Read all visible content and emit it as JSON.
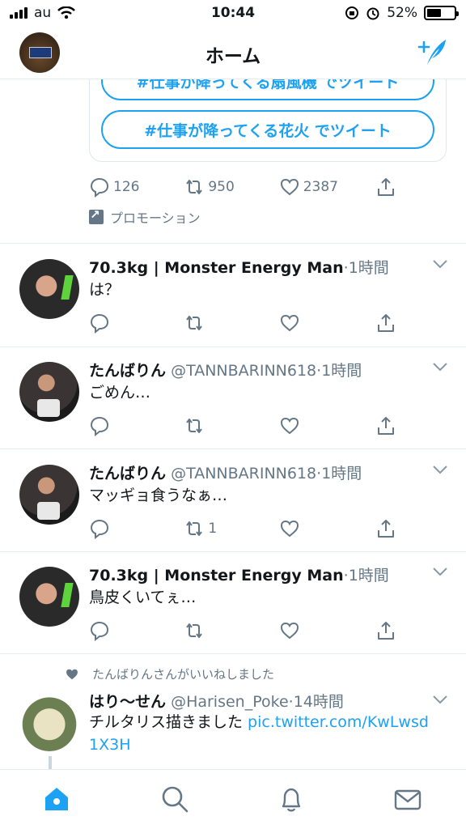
{
  "status_bar": {
    "carrier": "au",
    "time": "10:44",
    "battery_percent": "52%",
    "battery_level": 0.52
  },
  "header": {
    "title": "ホーム",
    "icons": [
      "profile-avatar",
      "compose-icon"
    ]
  },
  "promo": {
    "buttons": [
      "#仕事が降ってくる扇風機 でツイート",
      "#仕事が降ってくる花火 でツイート"
    ],
    "counts": {
      "replies": "126",
      "retweets": "950",
      "likes": "2387"
    },
    "promoted_label": "プロモーション"
  },
  "tweets": [
    {
      "name": "70.3kg | Monster Energy Man",
      "handle": "",
      "time": "1時間",
      "text": "は？",
      "retweets": ""
    },
    {
      "name": "たんばりん",
      "handle": "@TANNBARINN618",
      "time": "1時間",
      "text": "ごめん…",
      "retweets": ""
    },
    {
      "name": "たんばりん",
      "handle": "@TANNBARINN618",
      "time": "1時間",
      "text": "マッギョ食うなぁ…",
      "retweets": "1"
    },
    {
      "name": "70.3kg | Monster Energy Man",
      "handle": "",
      "time": "1時間",
      "text": "鳥皮くいてぇ…",
      "retweets": ""
    }
  ],
  "liked_tweet": {
    "note": "たんばりんさんがいいねしました",
    "name": "はり〜せん",
    "handle": "@Harisen_Poke",
    "time": "14時間",
    "text": "チルタリス描きました ",
    "link": "pic.twitter.com/KwLwsd1X3H"
  },
  "tab_bar": {
    "icons": [
      "home-icon",
      "search-icon",
      "notifications-icon",
      "messages-icon"
    ],
    "active": "home-icon"
  },
  "colors": {
    "accent": "#1da1f2",
    "muted": "#657786",
    "text": "#14171a"
  }
}
